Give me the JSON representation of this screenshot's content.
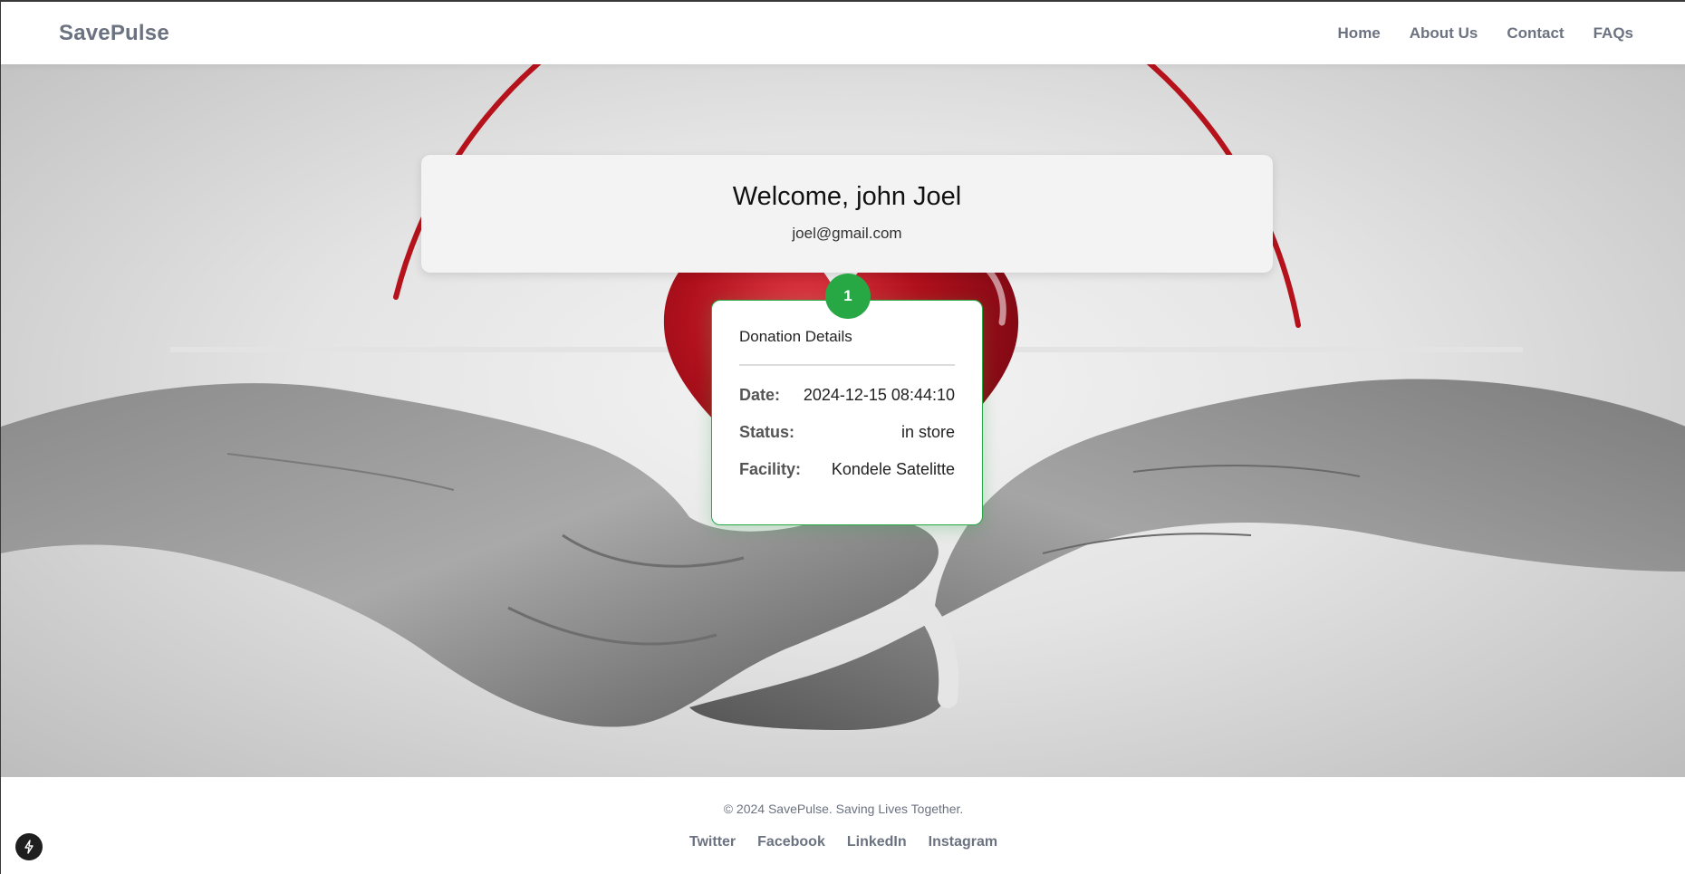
{
  "navbar": {
    "brand": "SavePulse",
    "links": [
      "Home",
      "About Us",
      "Contact",
      "FAQs"
    ]
  },
  "welcome": {
    "greeting": "Welcome, john Joel",
    "email": "joel@gmail.com"
  },
  "donation": {
    "index": "1",
    "title": "Donation Details",
    "details": [
      {
        "label": "Date:",
        "value": "2024-12-15 08:44:10"
      },
      {
        "label": "Status:",
        "value": "in store"
      },
      {
        "label": "Facility:",
        "value": "Kondele Satelitte"
      }
    ]
  },
  "footer": {
    "copyright": "© 2024 SavePulse. Saving Lives Together.",
    "social": [
      "Twitter",
      "Facebook",
      "LinkedIn",
      "Instagram"
    ]
  },
  "icons": {
    "floating_button": "lightning-icon"
  },
  "colors": {
    "accent_green": "#28a745",
    "nav_text": "#6b7280",
    "heart_red": "#b0101c"
  }
}
